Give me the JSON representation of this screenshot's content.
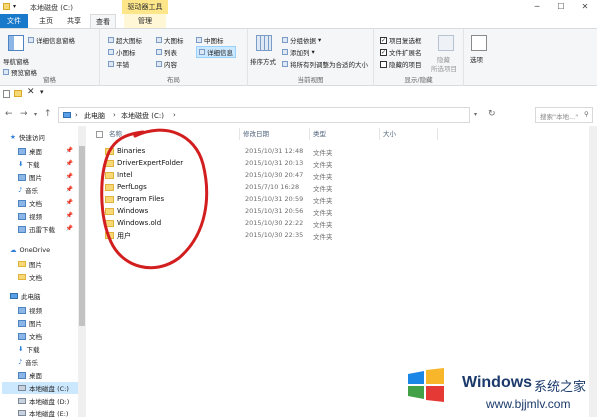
{
  "titlebar": {
    "title": "本地磁盘 (C:)",
    "context_tab": "驱动器工具",
    "controls": {
      "minimize": "─",
      "maximize": "☐",
      "close": "✕"
    }
  },
  "tabs": {
    "file": "文件",
    "home": "主页",
    "share": "共享",
    "view": "查看",
    "manage": "管理"
  },
  "ribbon": {
    "panes": {
      "label": "窗格",
      "nav_pane": "导航窗格",
      "preview_pane": "预览窗格",
      "details_pane": "详细信息窗格"
    },
    "layout": {
      "label": "布局",
      "items": [
        "超大图标",
        "大图标",
        "中图标",
        "小图标",
        "列表",
        "详细信息",
        "平铺",
        "内容"
      ]
    },
    "current_view": {
      "label": "当前视图",
      "sort_by": "排序方式",
      "group_by": "分组依据",
      "add_column": "添加列",
      "size_all_columns": "将所有列调整为合适的大小"
    },
    "show_hide": {
      "label": "显示/隐藏",
      "item_checkboxes": "项目复选框",
      "file_extensions": "文件扩展名",
      "hidden_items": "隐藏的项目",
      "hide_selected": "隐藏",
      "hide_selected_2": "所选项目"
    },
    "options": "选项"
  },
  "address": {
    "crumbs": [
      "此电脑",
      "本地磁盘 (C:)"
    ],
    "search_placeholder": "搜索\"本地...\""
  },
  "navpane": {
    "quick_access": "快速访问",
    "quick_items": [
      "桌面",
      "下载",
      "图片",
      "音乐",
      "文档",
      "视频",
      "迅雷下载"
    ],
    "onedrive": "OneDrive",
    "onedrive_items": [
      "图片",
      "文档"
    ],
    "this_pc": "此电脑",
    "pc_items": [
      "视频",
      "图片",
      "文档",
      "下载",
      "音乐",
      "桌面",
      "本地磁盘 (C:)",
      "本地磁盘 (D:)",
      "本地磁盘 (E:)"
    ]
  },
  "columns": {
    "name": "名称",
    "date": "修改日期",
    "type": "类型",
    "size": "大小"
  },
  "files": [
    {
      "name": "Binaries",
      "date": "2015/10/31 12:48",
      "type": "文件夹"
    },
    {
      "name": "DriverExpertFolder",
      "date": "2015/10/31 20:13",
      "type": "文件夹"
    },
    {
      "name": "Intel",
      "date": "2015/10/30 20:47",
      "type": "文件夹"
    },
    {
      "name": "PerfLogs",
      "date": "2015/7/10 16:28",
      "type": "文件夹"
    },
    {
      "name": "Program Files",
      "date": "2015/10/31 20:59",
      "type": "文件夹"
    },
    {
      "name": "Windows",
      "date": "2015/10/31 20:56",
      "type": "文件夹"
    },
    {
      "name": "Windows.old",
      "date": "2015/10/30 22:22",
      "type": "文件夹"
    },
    {
      "name": "用户",
      "date": "2015/10/30 22:35",
      "type": "文件夹"
    }
  ],
  "watermark": {
    "brand": "Windows",
    "site_name": "系统之家",
    "url": "www.bjjmlv.com"
  },
  "colors": {
    "accent": "#1979ca",
    "annotation": "#d21e1e",
    "context_tab": "#fde68a"
  }
}
